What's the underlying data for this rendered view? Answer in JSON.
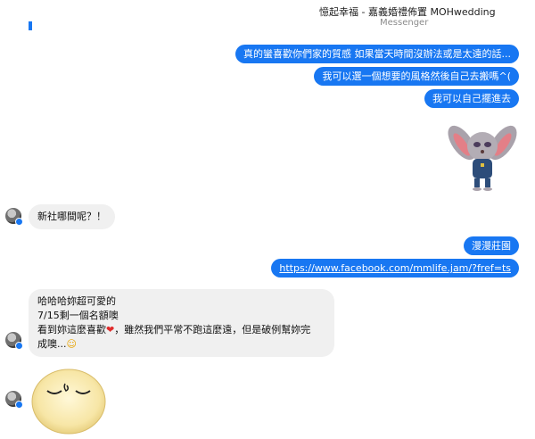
{
  "header": {
    "title": "憶起幸福 - 嘉義婚禮佈置 MOHwedding",
    "subtitle": "Messenger"
  },
  "messages_out": [
    "真的蠻喜歡你們家的質感 如果當天時間沒辦法或是太遠的話...",
    "我可以選一個想要的風格然後自己去搬嗎^(",
    "我可以自己擺進去",
    "漫漫莊園",
    "https://www.facebook.com/mmlife.jam/?fref=ts"
  ],
  "messages_in": {
    "msg1": "新社哪間呢？！",
    "msg2_line1": "哈哈哈妳超可愛的",
    "msg2_line2": "7/15剩一個名額噢",
    "msg2_line3a": "看到妳這麼喜歡",
    "msg2_line3b": "，雖然我們平常不跑這麼遠，但是破例幫妳完",
    "msg2_line4": "成噢...",
    "heart_glyph": "❤",
    "smile_glyph": "☺"
  },
  "icons": {
    "avatar": "contact-avatar",
    "sticker_bunny": "bunny-officer-sticker",
    "sticker_emoji": "smug-face-sticker"
  },
  "colors": {
    "accent": "#1877f2",
    "incoming_bubble": "#f0f0f0"
  }
}
